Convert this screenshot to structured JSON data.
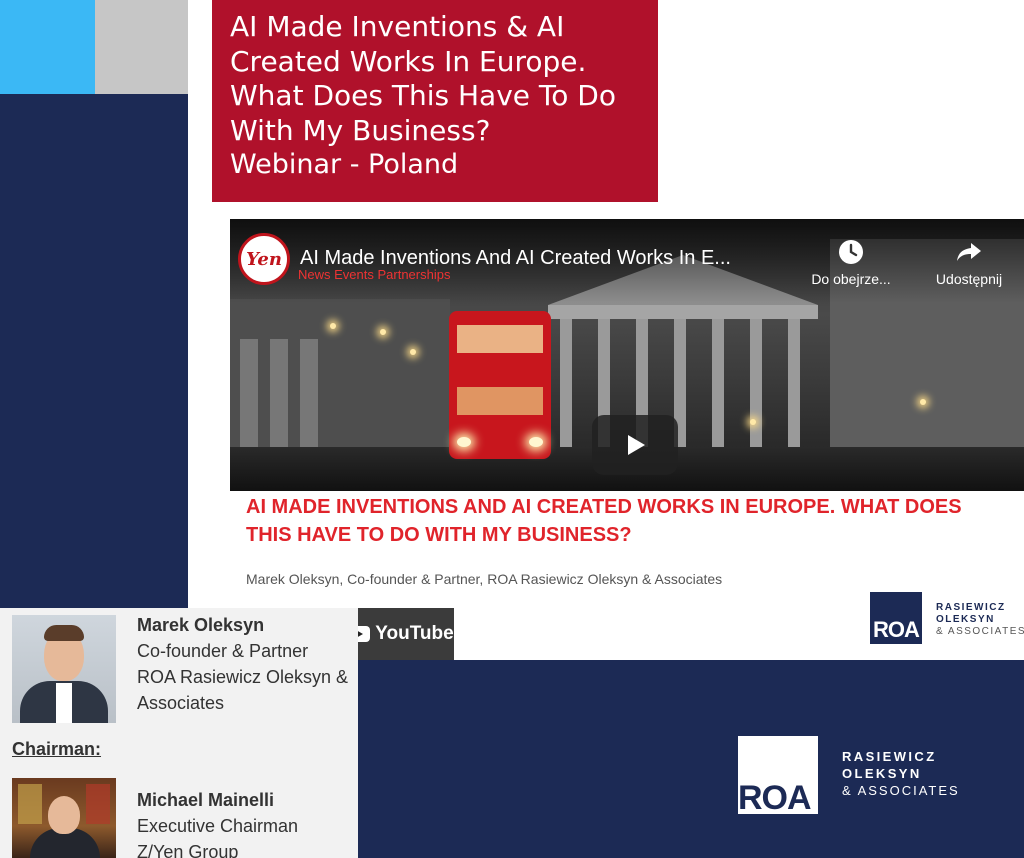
{
  "title_box": {
    "lines": [
      "AI Made Inventions & AI",
      "Created Works In Europe.",
      "What Does This Have To Do",
      "With My Business?"
    ],
    "subtitle": "Webinar - Poland"
  },
  "video": {
    "title": "AI Made Inventions And AI Created Works In E...",
    "channel_logo_text": "Yen",
    "channel_sub": "News Events Partnerships",
    "watch_later_label": "Do obejrze...",
    "share_label": "Udostępnij",
    "caption": "AI MADE INVENTIONS AND AI CREATED WORKS IN EUROPE. WHAT DOES THIS HAVE TO DO WITH MY BUSINESS?",
    "author": "Marek Oleksyn, Co-founder & Partner, ROA Rasiewicz Oleksyn & Associates",
    "youtube_label": "YouTube",
    "roa_initials": "ROA",
    "roa_name_1": "RASIEWICZ",
    "roa_name_2": "OLEKSYN",
    "roa_name_3": "& ASSOCIATES"
  },
  "speakers": {
    "speaker1": {
      "name": "Marek Oleksyn",
      "line1": "Co-founder & Partner",
      "line2": "ROA Rasiewicz Oleksyn &",
      "line3": "Associates"
    },
    "chairman_label": "Chairman:",
    "speaker2": {
      "name": "Michael Mainelli",
      "line1": "Executive Chairman",
      "line2": "Z/Yen Group"
    }
  },
  "roa_logo": {
    "initials": "ROA",
    "name_1": "RASIEWICZ",
    "name_2": "OLEKSYN",
    "name_3": "& ASSOCIATES"
  },
  "colors": {
    "navy": "#1c2a55",
    "crimson": "#b0112b",
    "cyan": "#3bb8f5",
    "grey": "#c6c6c6",
    "caption_red": "#e0242b"
  }
}
